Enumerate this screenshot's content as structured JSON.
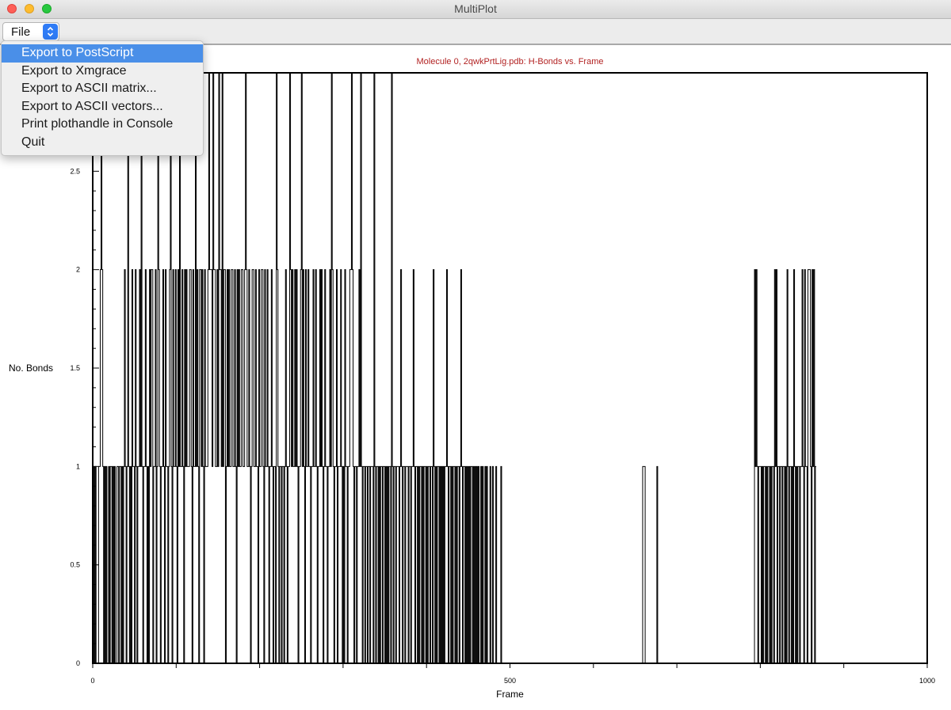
{
  "window": {
    "title": "MultiPlot"
  },
  "toolbar": {
    "file_menu_label": "File"
  },
  "menu": {
    "items": [
      "Export to PostScript",
      "Export to Xmgrace",
      "Export to ASCII matrix...",
      "Export to ASCII vectors...",
      "Print plothandle in Console",
      "Quit"
    ],
    "selected_index": 0
  },
  "chart_data": {
    "type": "line",
    "title": "Molecule 0, 2qwkPrtLig.pdb: H-Bonds vs. Frame",
    "xlabel": "Frame",
    "ylabel": "No. Bonds",
    "xlim": [
      0,
      1000
    ],
    "ylim": [
      0,
      3
    ],
    "x_ticks": [
      0,
      500,
      1000
    ],
    "y_ticks": [
      "0",
      "0.5",
      "1",
      "1.5",
      "2",
      "2.5"
    ],
    "series": [
      {
        "x_start": 0,
        "x_step": 1,
        "values": [
          0,
          1,
          0,
          1,
          0,
          0,
          0,
          1,
          1,
          2,
          3,
          2,
          1,
          0,
          1,
          0,
          1,
          0,
          0,
          1,
          0,
          1,
          1,
          0,
          1,
          0,
          1,
          0,
          0,
          1,
          1,
          0,
          1,
          1,
          0,
          1,
          0,
          1,
          2,
          1,
          0,
          1,
          3,
          1,
          0,
          1,
          0,
          2,
          1,
          1,
          0,
          2,
          1,
          0,
          1,
          1,
          2,
          1,
          3,
          1,
          0,
          1,
          1,
          2,
          1,
          0,
          1,
          0,
          2,
          1,
          2,
          2,
          0,
          1,
          1,
          2,
          0,
          1,
          3,
          2,
          1,
          0,
          1,
          1,
          2,
          1,
          0,
          2,
          1,
          1,
          0,
          1,
          2,
          3,
          1,
          0,
          2,
          1,
          1,
          2,
          1,
          0,
          2,
          1,
          3,
          1,
          1,
          2,
          1,
          0,
          2,
          1,
          2,
          1,
          1,
          1,
          2,
          2,
          1,
          0,
          2,
          1,
          1,
          3,
          1,
          2,
          1,
          0,
          2,
          2,
          1,
          2,
          1,
          0,
          2,
          1,
          1,
          1,
          2,
          3,
          2,
          2,
          2,
          1,
          3,
          2,
          2,
          1,
          1,
          2,
          1,
          3,
          2,
          2,
          1,
          3,
          1,
          2,
          2,
          0,
          1,
          2,
          1,
          2,
          1,
          1,
          2,
          2,
          1,
          1,
          2,
          1,
          0,
          2,
          1,
          2,
          1,
          1,
          2,
          2,
          1,
          1,
          2,
          3,
          2,
          1,
          1,
          2,
          1,
          0,
          1,
          2,
          2,
          1,
          1,
          2,
          1,
          1,
          0,
          2,
          1,
          1,
          2,
          2,
          1,
          0,
          2,
          1,
          1,
          2,
          1,
          0,
          1,
          1,
          2,
          1,
          0,
          1,
          1,
          0,
          3,
          2,
          1,
          0,
          1,
          1,
          0,
          1,
          1,
          0,
          1,
          2,
          1,
          0,
          1,
          1,
          3,
          2,
          1,
          2,
          1,
          1,
          2,
          1,
          2,
          1,
          0,
          1,
          1,
          2,
          3,
          1,
          2,
          1,
          0,
          2,
          1,
          1,
          2,
          1,
          1,
          0,
          1,
          1,
          2,
          1,
          1,
          2,
          1,
          0,
          1,
          1,
          2,
          1,
          2,
          1,
          0,
          1,
          2,
          1,
          1,
          0,
          1,
          1,
          2,
          1,
          3,
          2,
          1,
          0,
          1,
          1,
          2,
          0,
          1,
          1,
          1,
          2,
          1,
          0,
          1,
          0,
          2,
          1,
          1,
          0,
          1,
          1,
          2,
          2,
          3,
          2,
          1,
          0,
          1,
          1,
          0,
          1,
          1,
          2,
          1,
          3,
          1,
          0,
          1,
          1,
          0,
          1,
          1,
          0,
          1,
          1,
          0,
          1,
          1,
          1,
          0,
          3,
          1,
          0,
          1,
          1,
          0,
          1,
          0,
          1,
          1,
          0,
          1,
          1,
          0,
          1,
          0,
          1,
          0,
          1,
          1,
          0,
          3,
          1,
          0,
          1,
          1,
          0,
          1,
          1,
          1,
          0,
          1,
          2,
          1,
          0,
          1,
          1,
          0,
          1,
          1,
          1,
          0,
          1,
          1,
          0,
          1,
          1,
          2,
          1,
          0,
          1,
          1,
          0,
          1,
          0,
          1,
          1,
          0,
          1,
          0,
          1,
          1,
          0,
          1,
          0,
          1,
          1,
          0,
          1,
          1,
          0,
          2,
          1,
          0,
          1,
          0,
          1,
          1,
          0,
          1,
          0,
          1,
          0,
          1,
          0,
          1,
          1,
          2,
          1,
          0,
          1,
          1,
          0,
          1,
          0,
          1,
          1,
          0,
          1,
          0,
          1,
          1,
          0,
          1,
          2,
          1,
          0,
          1,
          1,
          0,
          1,
          0,
          1,
          0,
          1,
          0,
          1,
          1,
          0,
          1,
          0,
          1,
          0,
          1,
          0,
          1,
          0,
          0,
          1,
          0,
          1,
          0,
          0,
          1,
          0,
          1,
          0,
          0,
          0,
          1,
          0,
          0,
          1,
          0,
          0,
          0,
          1,
          0,
          0,
          0,
          0,
          0,
          1,
          0,
          0,
          0,
          0,
          0,
          0,
          0,
          0,
          0,
          0,
          0,
          0,
          0,
          0,
          0,
          0,
          0,
          0,
          0,
          0,
          0,
          0,
          0,
          0,
          0,
          0,
          0,
          0,
          0,
          0,
          0,
          0,
          0,
          0,
          0,
          0,
          0,
          0,
          0,
          0,
          0,
          0,
          0,
          0,
          0,
          0,
          0,
          0,
          0,
          0,
          0,
          0,
          0,
          0,
          0,
          0,
          0,
          0,
          0,
          0,
          0,
          0,
          0,
          0,
          0,
          0,
          0,
          0,
          0,
          0,
          0,
          0,
          0,
          0,
          0,
          0,
          0,
          0,
          0,
          0,
          0,
          0,
          0,
          0,
          0,
          0,
          0,
          0,
          0,
          0,
          0,
          0,
          0,
          0,
          0,
          0,
          0,
          0,
          0,
          0,
          0,
          0,
          0,
          0,
          0,
          0,
          0,
          0,
          0,
          0,
          0,
          0,
          0,
          0,
          0,
          0,
          0,
          0,
          0,
          0,
          0,
          0,
          0,
          0,
          0,
          0,
          0,
          0,
          0,
          0,
          0,
          0,
          0,
          0,
          0,
          0,
          0,
          0,
          0,
          0,
          0,
          0,
          0,
          0,
          0,
          0,
          0,
          0,
          0,
          0,
          0,
          0,
          0,
          0,
          0,
          0,
          0,
          0,
          0,
          0,
          0,
          0,
          0,
          0,
          0,
          0,
          0,
          0,
          0,
          1,
          1,
          1,
          0,
          0,
          0,
          0,
          0,
          0,
          0,
          0,
          0,
          0,
          0,
          0,
          0,
          0,
          1,
          0,
          0,
          0,
          0,
          0,
          0,
          0,
          0,
          0,
          0,
          0,
          0,
          0,
          0,
          0,
          0,
          0,
          0,
          0,
          0,
          0,
          0,
          0,
          0,
          0,
          0,
          0,
          0,
          0,
          0,
          0,
          0,
          0,
          0,
          0,
          0,
          0,
          0,
          0,
          0,
          0,
          0,
          0,
          0,
          0,
          0,
          0,
          0,
          0,
          0,
          0,
          0,
          0,
          0,
          0,
          0,
          0,
          0,
          0,
          0,
          0,
          0,
          0,
          0,
          0,
          0,
          0,
          0,
          0,
          0,
          0,
          0,
          0,
          0,
          0,
          0,
          0,
          0,
          0,
          0,
          0,
          0,
          0,
          0,
          0,
          0,
          0,
          0,
          0,
          0,
          0,
          0,
          0,
          0,
          0,
          0,
          0,
          0,
          0,
          0,
          0,
          0,
          0,
          0,
          0,
          0,
          0,
          0,
          0,
          0,
          0,
          0,
          0,
          0,
          0,
          0,
          2,
          1,
          2,
          1,
          0,
          1,
          1,
          1,
          0,
          1,
          0,
          1,
          1,
          0,
          1,
          0,
          1,
          1,
          0,
          1,
          0,
          1,
          1,
          0,
          2,
          1,
          2,
          0,
          1,
          1,
          0,
          1,
          1,
          0,
          1,
          1,
          0,
          1,
          0,
          2,
          1,
          0,
          1,
          1,
          0,
          1,
          0,
          2,
          1,
          0,
          1,
          0,
          1,
          1,
          0,
          1,
          1,
          2,
          1,
          0,
          2,
          1,
          1,
          0,
          2,
          2,
          2,
          1,
          0,
          2,
          1,
          2,
          0,
          1
        ]
      }
    ]
  }
}
